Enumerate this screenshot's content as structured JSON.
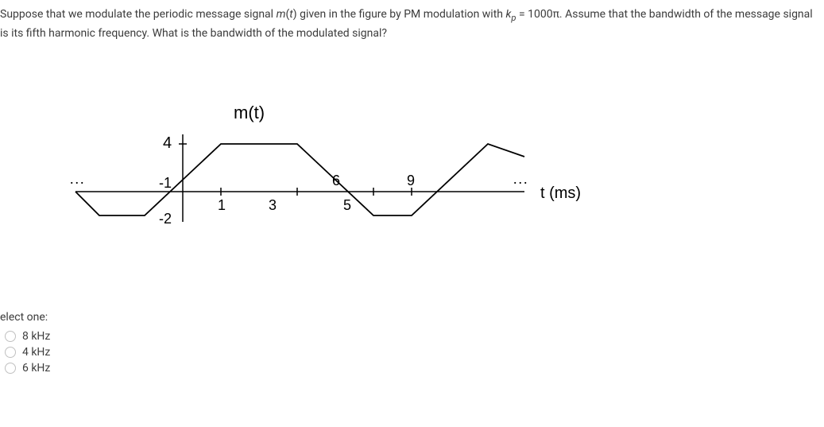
{
  "question": {
    "text_part1": "Suppose that we modulate the periodic message signal ",
    "m_t": "m",
    "m_t_paren": "(",
    "t_var": "t",
    "m_t_close": ") given in the figure by PM modulation with ",
    "kp_k": "k",
    "kp_p": "p",
    "eq": " = 1000π. Assume that the bandwidth of the message signal is its fifth harmonic frequency.  What is the bandwidth of the modulated signal?"
  },
  "figure": {
    "ylabel": "m(t)",
    "y_val_top": "4",
    "y_val_neg1": "-1",
    "y_val_neg2": "-2",
    "x_ticks": [
      "1",
      "3",
      "5",
      "6",
      "9"
    ],
    "x_unit": "t (ms)",
    "ellipsis_left": "...",
    "ellipsis_right": "..."
  },
  "prompt": "elect one:",
  "options": [
    {
      "label": "8 kHz"
    },
    {
      "label": "4 kHz"
    },
    {
      "label": "6 kHz"
    }
  ]
}
